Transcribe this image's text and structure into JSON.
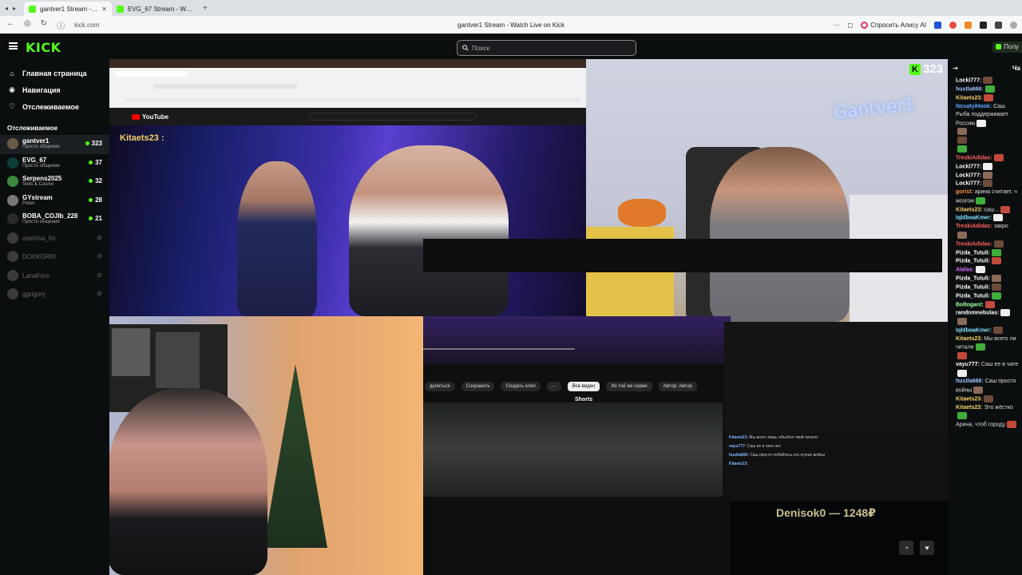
{
  "browser": {
    "tabs": [
      {
        "title": "gantver1 Stream - Watch Live on Kick",
        "active": true
      },
      {
        "title": "EVG_67 Stream - Watch Live on Kick",
        "active": false
      }
    ],
    "url": "kick.com",
    "page_title": "gantver1 Stream - Watch Live on Kick",
    "alice_label": "Спросить Алису AI"
  },
  "kick": {
    "logo": "KICK",
    "search_placeholder": "Поиск",
    "login_label": "Полу",
    "nav": [
      {
        "label": "Главная страница",
        "icon": "home-icon"
      },
      {
        "label": "Навигация",
        "icon": "compass-icon"
      },
      {
        "label": "Отслеживаемое",
        "icon": "heart-icon"
      }
    ],
    "following_title": "Отслеживаемое",
    "channels": [
      {
        "name": "gantver1",
        "category": "Просто общение",
        "viewers": "323",
        "live": true
      },
      {
        "name": "EVG_67",
        "category": "Просто общение",
        "viewers": "37",
        "live": true
      },
      {
        "name": "Serpens2025",
        "category": "Slots & Casino",
        "viewers": "32",
        "live": true
      },
      {
        "name": "GYstream",
        "category": "Poker",
        "viewers": "28",
        "live": true
      },
      {
        "name": "BOBA_COJIb_228",
        "category": "Просто общение",
        "viewers": "21",
        "live": true
      },
      {
        "name": "osetrina_fm",
        "category": "",
        "viewers": "",
        "live": false
      },
      {
        "name": "DOKKORKI",
        "category": "",
        "viewers": "",
        "live": false
      },
      {
        "name": "LanaFors",
        "category": "",
        "viewers": "",
        "live": false
      },
      {
        "name": "ggrigory",
        "category": "",
        "viewers": "",
        "live": false
      }
    ]
  },
  "stream": {
    "overlay_name": "Kitaets23 :",
    "viewer_count": "323",
    "yt_label": "YouTube",
    "actions": [
      "делиться",
      "Сохранить",
      "Создать клип"
    ],
    "chips": [
      "Все видео",
      "Из той же серии",
      "Автор: Автор"
    ],
    "shorts_label": "Shorts",
    "donate": "Denisok0 — 1248₽",
    "inner_chat": [
      {
        "user": "Kitaets23:",
        "text": "Мы всего лишь объебон твой читали"
      },
      {
        "user": "vayu777:",
        "text": "Саш ее в чате нет"
      },
      {
        "user": "hustla666:",
        "text": "Саш просто побейтесь,это лучше войны"
      },
      {
        "user": "Kitaets23:",
        "text": ""
      }
    ]
  },
  "chat": {
    "title": "Ча",
    "messages": [
      {
        "user": "Locki777:",
        "text": "",
        "color": "#ffffff"
      },
      {
        "user": "hustla666:",
        "text": "",
        "color": "#9ec3ff"
      },
      {
        "user": "Kitaets23:",
        "text": "",
        "color": "#f5d36a"
      },
      {
        "user": "NosatyiHook:",
        "text": "Саш Рыба поддерживает Россию",
        "color": "#5fa8ff"
      },
      {
        "user": "",
        "text": "",
        "color": "#e05656"
      },
      {
        "user": "",
        "text": "",
        "color": "#e05656"
      },
      {
        "user": "",
        "text": "",
        "color": "#e05656"
      },
      {
        "user": "TreskiAdidas:",
        "text": "",
        "color": "#ff6060"
      },
      {
        "user": "Locki777:",
        "text": "",
        "color": "#ffffff"
      },
      {
        "user": "Locki777:",
        "text": "",
        "color": "#ffffff"
      },
      {
        "user": "Locki777:",
        "text": "",
        "color": "#ffffff"
      },
      {
        "user": "gorist:",
        "text": "арина считает, ч мозгом",
        "color": "#ff8a3d"
      },
      {
        "user": "Kitaets23:",
        "text": "саш...",
        "color": "#f5d36a"
      },
      {
        "user": "IqldboaKmer:",
        "text": "",
        "color": "#7fe3ff"
      },
      {
        "user": "TreskiAdidas:",
        "text": "закро",
        "color": "#ff6060"
      },
      {
        "user": "TreskiAdidas:",
        "text": "",
        "color": "#ff6060"
      },
      {
        "user": "Pizda_Tutuli:",
        "text": "",
        "color": "#ffffff"
      },
      {
        "user": "Pizda_Tutuli:",
        "text": "",
        "color": "#ffffff"
      },
      {
        "user": "Alalas:",
        "text": "",
        "color": "#d16bff"
      },
      {
        "user": "Pizda_Tutuli:",
        "text": "",
        "color": "#ffffff"
      },
      {
        "user": "Pizda_Tutuli:",
        "text": "",
        "color": "#ffffff"
      },
      {
        "user": "Pizda_Tutuli:",
        "text": "",
        "color": "#ffffff"
      },
      {
        "user": "Boltogant:",
        "text": "",
        "color": "#9effa0"
      },
      {
        "user": "randomnebulas:",
        "text": "",
        "color": "#ffffff"
      },
      {
        "user": "",
        "text": "",
        "color": "#e05656"
      },
      {
        "user": "IqldboaKmer:",
        "text": "",
        "color": "#7fe3ff"
      },
      {
        "user": "Kitaets23:",
        "text": "Мы всего ли читали",
        "color": "#f5d36a"
      },
      {
        "user": "",
        "text": "",
        "color": "#e05656"
      },
      {
        "user": "vayu777:",
        "text": "Саш ее в чате",
        "color": "#ffffff"
      },
      {
        "user": "hustla666:",
        "text": "Саш просто войны",
        "color": "#9ec3ff"
      },
      {
        "user": "Kitaets23:",
        "text": "",
        "color": "#f5d36a"
      },
      {
        "user": "Kitaets23:",
        "text": "Это жёстко",
        "color": "#f5d36a"
      },
      {
        "user": "",
        "text": "Арина, чтоб городу",
        "color": "#e05656"
      }
    ]
  }
}
